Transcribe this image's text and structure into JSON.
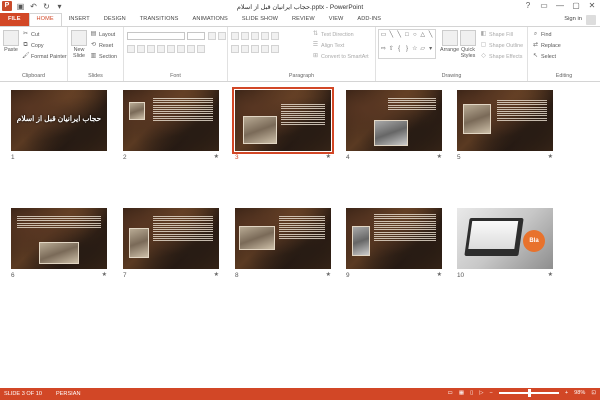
{
  "window": {
    "title": "حجاب ایرانیان قبل از اسلام.pptx - PowerPoint",
    "app_logo": "P",
    "controls": [
      "?",
      "▭",
      "—",
      "▢",
      "✕"
    ]
  },
  "qat": {
    "icons": [
      "save-icon",
      "undo-icon",
      "redo-icon",
      "customize-icon"
    ]
  },
  "tabs": [
    "FILE",
    "HOME",
    "INSERT",
    "DESIGN",
    "TRANSITIONS",
    "ANIMATIONS",
    "SLIDE SHOW",
    "REVIEW",
    "VIEW",
    "ADD-INS"
  ],
  "active_tab": "HOME",
  "signin": "Sign in",
  "ribbon": {
    "clipboard": {
      "paste": "Paste",
      "cut": "Cut",
      "copy": "Copy",
      "format_painter": "Format Painter",
      "label": "Clipboard"
    },
    "slides": {
      "new_slide": "New Slide",
      "layout": "Layout",
      "reset": "Reset",
      "section": "Section",
      "label": "Slides"
    },
    "font": {
      "label": "Font"
    },
    "paragraph": {
      "text_direction": "Text Direction",
      "align_text": "Align Text",
      "convert_smartart": "Convert to SmartArt",
      "label": "Paragraph"
    },
    "drawing": {
      "arrange": "Arrange",
      "quick_styles": "Quick Styles",
      "shape_fill": "Shape Fill",
      "shape_outline": "Shape Outline",
      "shape_effects": "Shape Effects",
      "label": "Drawing"
    },
    "editing": {
      "find": "Find",
      "replace": "Replace",
      "select": "Select",
      "label": "Editing"
    }
  },
  "slides": [
    {
      "num": "1",
      "title": "حجاب ایرانیان قبل از اسلام",
      "star": ""
    },
    {
      "num": "2",
      "title": "",
      "star": "★"
    },
    {
      "num": "3",
      "title": "",
      "star": "★"
    },
    {
      "num": "4",
      "title": "",
      "star": "★"
    },
    {
      "num": "5",
      "title": "",
      "star": "★"
    },
    {
      "num": "6",
      "title": "",
      "star": "★"
    },
    {
      "num": "7",
      "title": "",
      "star": "★"
    },
    {
      "num": "8",
      "title": "",
      "star": "★"
    },
    {
      "num": "9",
      "title": "",
      "star": "★"
    },
    {
      "num": "10",
      "title": "",
      "star": "★",
      "brand": "Bla"
    }
  ],
  "selected_slide": "3",
  "status": {
    "slide_info": "SLIDE 3 OF 10",
    "language": "PERSIAN",
    "zoom": "98%",
    "zoom_minus": "−",
    "zoom_plus": "+"
  },
  "colors": {
    "accent": "#d24726"
  }
}
